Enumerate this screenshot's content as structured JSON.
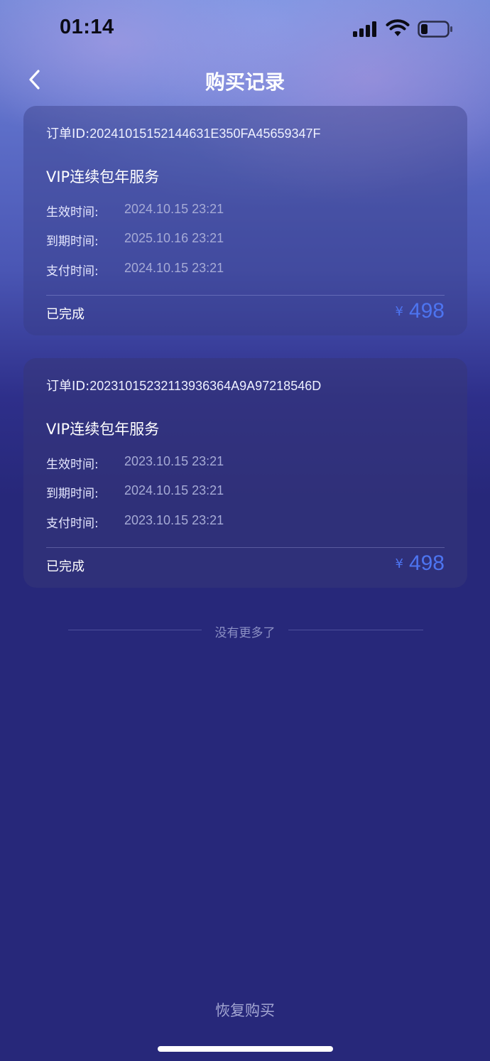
{
  "status_bar": {
    "time": "01:14"
  },
  "header": {
    "title": "购买记录"
  },
  "orders": [
    {
      "order_id_label": "订单ID:",
      "order_id": "20241015152144631E350FA45659347F",
      "product": "VIP连续包年服务",
      "rows": [
        {
          "label": "生效时间:",
          "value": "2024.10.15 23:21"
        },
        {
          "label": "到期时间:",
          "value": "2025.10.16 23:21"
        },
        {
          "label": "支付时间:",
          "value": "2024.10.15 23:21"
        }
      ],
      "status": "已完成",
      "currency": "¥",
      "amount": "498"
    },
    {
      "order_id_label": "订单ID:",
      "order_id": "20231015232113936364A9A97218546D",
      "product": "VIP连续包年服务",
      "rows": [
        {
          "label": "生效时间:",
          "value": "2023.10.15 23:21"
        },
        {
          "label": "到期时间:",
          "value": "2024.10.15 23:21"
        },
        {
          "label": "支付时间:",
          "value": "2023.10.15 23:21"
        }
      ],
      "status": "已完成",
      "currency": "¥",
      "amount": "498"
    }
  ],
  "list_end_text": "没有更多了",
  "restore_label": "恢复购买",
  "colors": {
    "accent_price": "#4d74f0",
    "background_bottom": "#27287a"
  }
}
